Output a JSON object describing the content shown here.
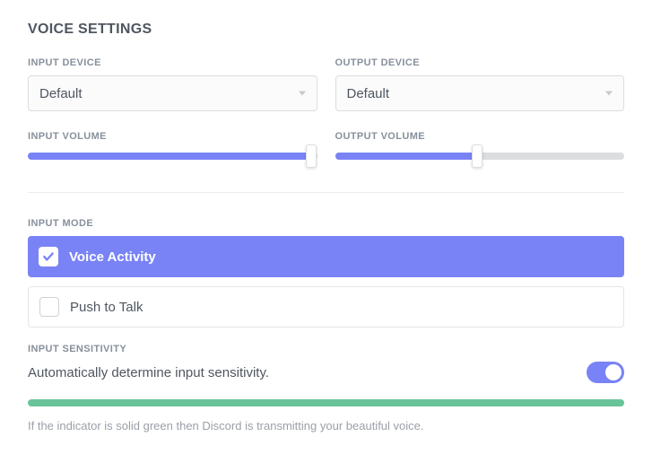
{
  "title": "VOICE SETTINGS",
  "inputDevice": {
    "label": "INPUT DEVICE",
    "value": "Default"
  },
  "outputDevice": {
    "label": "OUTPUT DEVICE",
    "value": "Default"
  },
  "inputVolume": {
    "label": "INPUT VOLUME",
    "value": 98
  },
  "outputVolume": {
    "label": "OUTPUT VOLUME",
    "value": 49
  },
  "inputMode": {
    "label": "INPUT MODE",
    "options": {
      "voiceActivity": "Voice Activity",
      "pushToTalk": "Push to Talk"
    }
  },
  "inputSensitivity": {
    "label": "INPUT SENSITIVITY",
    "autoText": "Automatically determine input sensitivity.",
    "helper": "If the indicator is solid green then Discord is transmitting your beautiful voice."
  },
  "colors": {
    "accent": "#7983f5",
    "green": "#69c49a"
  }
}
